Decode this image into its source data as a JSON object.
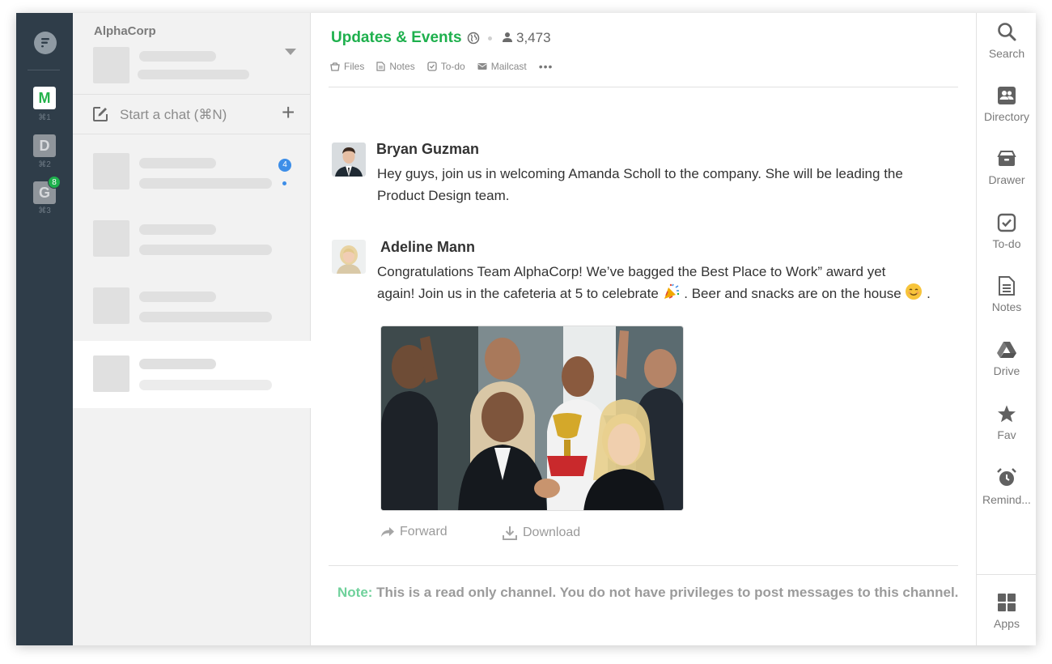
{
  "rail": {
    "workspaces": [
      {
        "letter": "M",
        "shortcut": "⌘1"
      },
      {
        "letter": "D",
        "shortcut": "⌘2"
      },
      {
        "letter": "G",
        "shortcut": "⌘3",
        "badge": "8"
      }
    ]
  },
  "panel": {
    "org_name": "AlphaCorp",
    "start_chat_label": "Start a chat (⌘N)",
    "first_item_unread": "4"
  },
  "channel": {
    "title": "Updates & Events",
    "member_count": "3,473",
    "tabs": {
      "files": "Files",
      "notes": "Notes",
      "todo": "To-do",
      "mailcast": "Mailcast",
      "more": "•••"
    }
  },
  "messages": [
    {
      "author": "Bryan Guzman",
      "text_line1": "Hey guys, join us in welcoming Amanda Scholl to the company. She will be leading the",
      "text_line2": "Product Design team."
    },
    {
      "author": "Adeline Mann",
      "text_line1": "Congratulations Team AlphaCorp! We’ve bagged the Best Place to Work” award yet",
      "text_line2_a": "again! Join us in the cafeteria at 5 to celebrate",
      "text_line2_b": ". Beer and snacks are on the house",
      "text_line2_c": "."
    }
  ],
  "attachment_actions": {
    "forward": "Forward",
    "download": "Download"
  },
  "readonly_note": {
    "label": "Note:",
    "text": " This is a read only channel. You do not have privileges to post messages to this channel."
  },
  "right_toolbar": {
    "search": "Search",
    "directory": "Directory",
    "drawer": "Drawer",
    "todo": "To-do",
    "notes": "Notes",
    "drive": "Drive",
    "fav": "Fav",
    "reminders": "Remind...",
    "apps": "Apps"
  },
  "colors": {
    "accent": "#1eb04d",
    "rail": "#2f3d49",
    "badge": "#3d8ee8"
  }
}
